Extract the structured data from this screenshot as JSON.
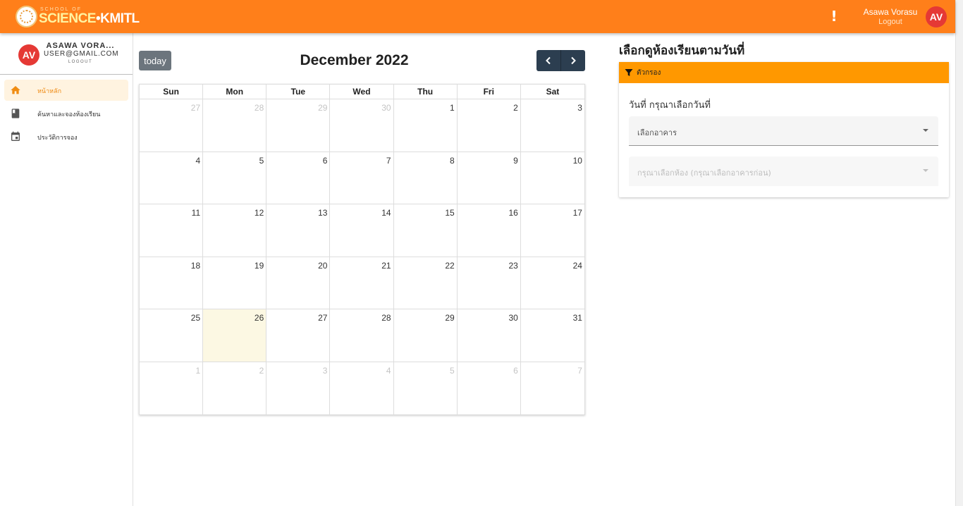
{
  "header": {
    "logo_small": "SCHOOL OF",
    "logo_science": "SCIENCE",
    "logo_kmitl": "KMITL",
    "user_name": "Asawa Vorasu",
    "logout": "Logout",
    "avatar_initials": "AV",
    "alert_glyph": "!"
  },
  "sidebar": {
    "avatar_initials": "AV",
    "user_name": "ASAWA VORA...",
    "user_email": "USER@GMAIL.COM",
    "logout": "LOGOUT",
    "items": [
      {
        "label": "หน้าหลัก",
        "icon": "home-icon",
        "active": true
      },
      {
        "label": "ค้นหาและจองห้องเรียน",
        "icon": "book-icon",
        "active": false
      },
      {
        "label": "ประวัติการจอง",
        "icon": "calendar-icon",
        "active": false
      }
    ]
  },
  "calendar": {
    "today_label": "today",
    "title": "December 2022",
    "weekdays": [
      "Sun",
      "Mon",
      "Tue",
      "Wed",
      "Thu",
      "Fri",
      "Sat"
    ],
    "weeks": [
      [
        {
          "d": "27",
          "other": true
        },
        {
          "d": "28",
          "other": true
        },
        {
          "d": "29",
          "other": true
        },
        {
          "d": "30",
          "other": true
        },
        {
          "d": "1"
        },
        {
          "d": "2"
        },
        {
          "d": "3"
        }
      ],
      [
        {
          "d": "4"
        },
        {
          "d": "5"
        },
        {
          "d": "6"
        },
        {
          "d": "7"
        },
        {
          "d": "8"
        },
        {
          "d": "9"
        },
        {
          "d": "10"
        }
      ],
      [
        {
          "d": "11"
        },
        {
          "d": "12"
        },
        {
          "d": "13"
        },
        {
          "d": "14"
        },
        {
          "d": "15"
        },
        {
          "d": "16"
        },
        {
          "d": "17"
        }
      ],
      [
        {
          "d": "18"
        },
        {
          "d": "19"
        },
        {
          "d": "20"
        },
        {
          "d": "21"
        },
        {
          "d": "22"
        },
        {
          "d": "23"
        },
        {
          "d": "24"
        }
      ],
      [
        {
          "d": "25"
        },
        {
          "d": "26",
          "today": true
        },
        {
          "d": "27"
        },
        {
          "d": "28"
        },
        {
          "d": "29"
        },
        {
          "d": "30"
        },
        {
          "d": "31"
        }
      ],
      [
        {
          "d": "1",
          "other": true
        },
        {
          "d": "2",
          "other": true
        },
        {
          "d": "3",
          "other": true
        },
        {
          "d": "4",
          "other": true
        },
        {
          "d": "5",
          "other": true
        },
        {
          "d": "6",
          "other": true
        },
        {
          "d": "7",
          "other": true
        }
      ]
    ]
  },
  "panel": {
    "title": "เลือกดูห้องเรียนตามวันที่",
    "filter_label": "ตัวกรอง",
    "date_label": "วันที่ กรุณาเลือกวันที่",
    "building_select": "เลือกอาคาร",
    "room_select": "กรุณาเลือกห้อง (กรุณาเลือกอาคารก่อน)"
  },
  "colors": {
    "topbar": "#ff7f1a",
    "accent": "#ff9800",
    "avatar": "#e53935",
    "today_button": "#6c757d",
    "nav_buttons": "#2c3e50",
    "today_cell": "#fcf8e3"
  }
}
